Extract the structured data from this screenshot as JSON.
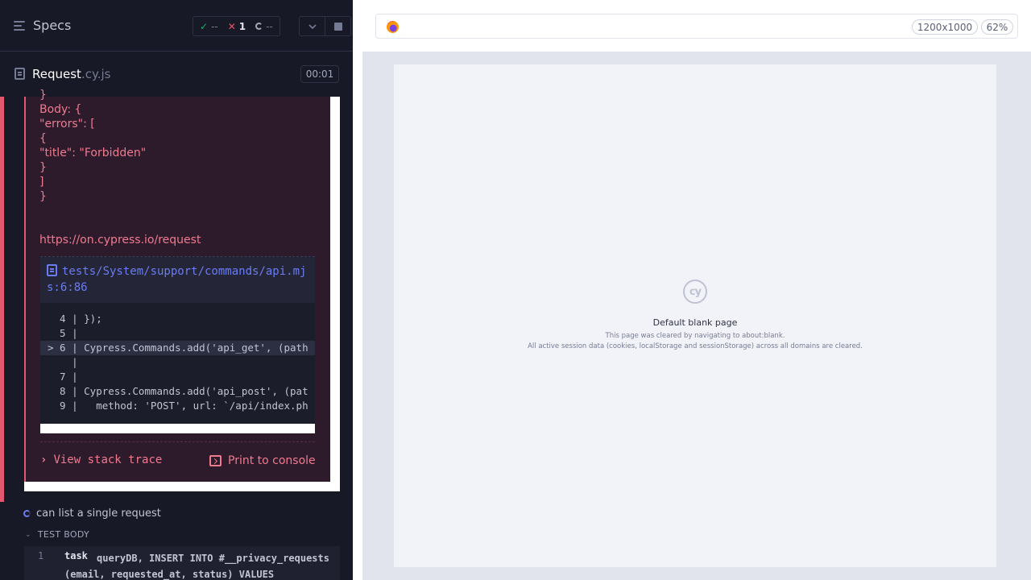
{
  "header": {
    "specs_label": "Specs",
    "passed": "--",
    "failed": "1",
    "pending": "--"
  },
  "file": {
    "name": "Request",
    "ext": ".cy.js",
    "duration": "00:01"
  },
  "error": {
    "lines": [
      "}",
      "Body: {",
      "\"errors\": [",
      "{",
      "\"title\": \"Forbidden\"",
      "}",
      "]",
      "}"
    ],
    "docs_link": "https://on.cypress.io/request",
    "code_frame": {
      "path": "tests/System/support/commands/api.mjs:6:86",
      "lines": [
        "  4 | });",
        "  5 |",
        "> 6 | Cypress.Commands.add('api_get', (path",
        "    |",
        "  7 |",
        "  8 | Cypress.Commands.add('api_post', (pat",
        "  9 |   method: 'POST', url: `/api/index.ph"
      ],
      "highlight_index": 2
    },
    "view_stack_label": "View stack trace",
    "print_label": "Print to console"
  },
  "next_test": {
    "title": "can list a single request",
    "section": "TEST BODY",
    "command": {
      "number": "1",
      "name": "task",
      "message": "queryDB, INSERT INTO #__privacy_requests (email, requested_at, status) VALUES"
    }
  },
  "aut": {
    "viewport": "1200x1000",
    "zoom": "62%",
    "logo_text": "cy",
    "title": "Default blank page",
    "sub1": "This page was cleared by navigating to about:blank.",
    "sub2": "All active session data (cookies, localStorage and sessionStorage) across all domains are cleared."
  },
  "colors": {
    "fail": "#e45770",
    "pass": "#1fa971",
    "accent": "#6b7cf2"
  }
}
